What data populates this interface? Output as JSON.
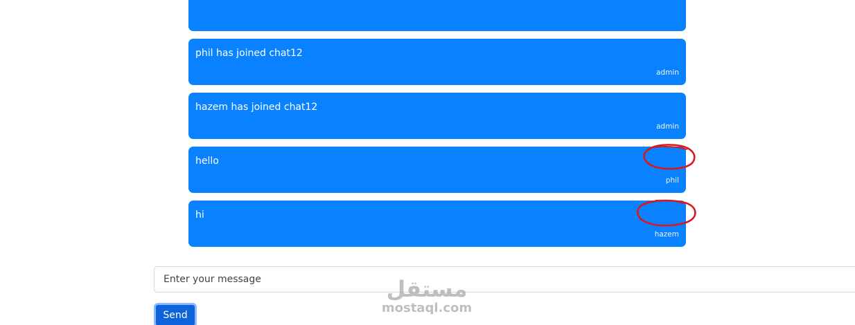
{
  "messages": [
    {
      "text": "",
      "sender": ""
    },
    {
      "text": "phil has joined chat12",
      "sender": "admin"
    },
    {
      "text": "hazem has joined chat12",
      "sender": "admin"
    },
    {
      "text": "hello",
      "sender": "phil"
    },
    {
      "text": "hi",
      "sender": "hazem"
    }
  ],
  "composer": {
    "placeholder": "Enter your message"
  },
  "send_button": {
    "label": "Send"
  },
  "watermark": {
    "logo_text": "مستقل",
    "url_text": "mostaql.com"
  },
  "colors": {
    "message_background": "#0a82ff",
    "send_button": "#0d63d9",
    "annotation": "#d71920"
  }
}
